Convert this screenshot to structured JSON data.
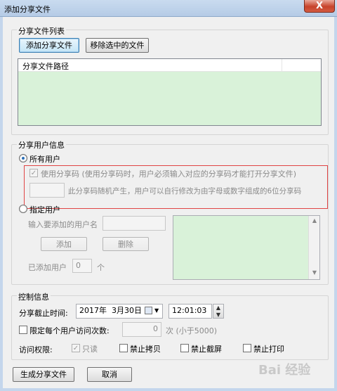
{
  "window": {
    "title": "添加分享文件",
    "close_glyph": "X"
  },
  "files_group": {
    "label": "分享文件列表",
    "add_button": "添加分享文件",
    "remove_button": "移除选中的文件",
    "table_header": "分享文件路径"
  },
  "users_group": {
    "label": "分享用户信息",
    "all_users_label": "所有用户",
    "use_code_label": "使用分享码 (使用分享码时，用户必须输入对应的分享码才能打开分享文件)",
    "code_value": "",
    "code_hint": "此分享码随机产生，用户可以自行修改为由字母或数字组成的6位分享码",
    "specified_users_label": "指定用户",
    "username_label": "输入要添加的用户名",
    "username_value": "",
    "add_button": "添加",
    "delete_button": "删除",
    "added_users_label": "已添加用户",
    "added_users_count": "0",
    "added_users_unit": "个"
  },
  "control_group": {
    "label": "控制信息",
    "deadline_label": "分享截止时间:",
    "deadline_date": "2017年  3月30日",
    "deadline_time": "12:01:03",
    "limit_label": "限定每个用户访问次数:",
    "limit_value": "0",
    "limit_unit": "次 (小于5000)",
    "permission_label": "访问权限:",
    "read_only": "只读",
    "no_copy": "禁止拷贝",
    "no_screenshot": "禁止截屏",
    "no_print": "禁止打印"
  },
  "footer": {
    "generate_button": "生成分享文件",
    "cancel_button": "取消"
  },
  "watermark": "Bai 经验"
}
